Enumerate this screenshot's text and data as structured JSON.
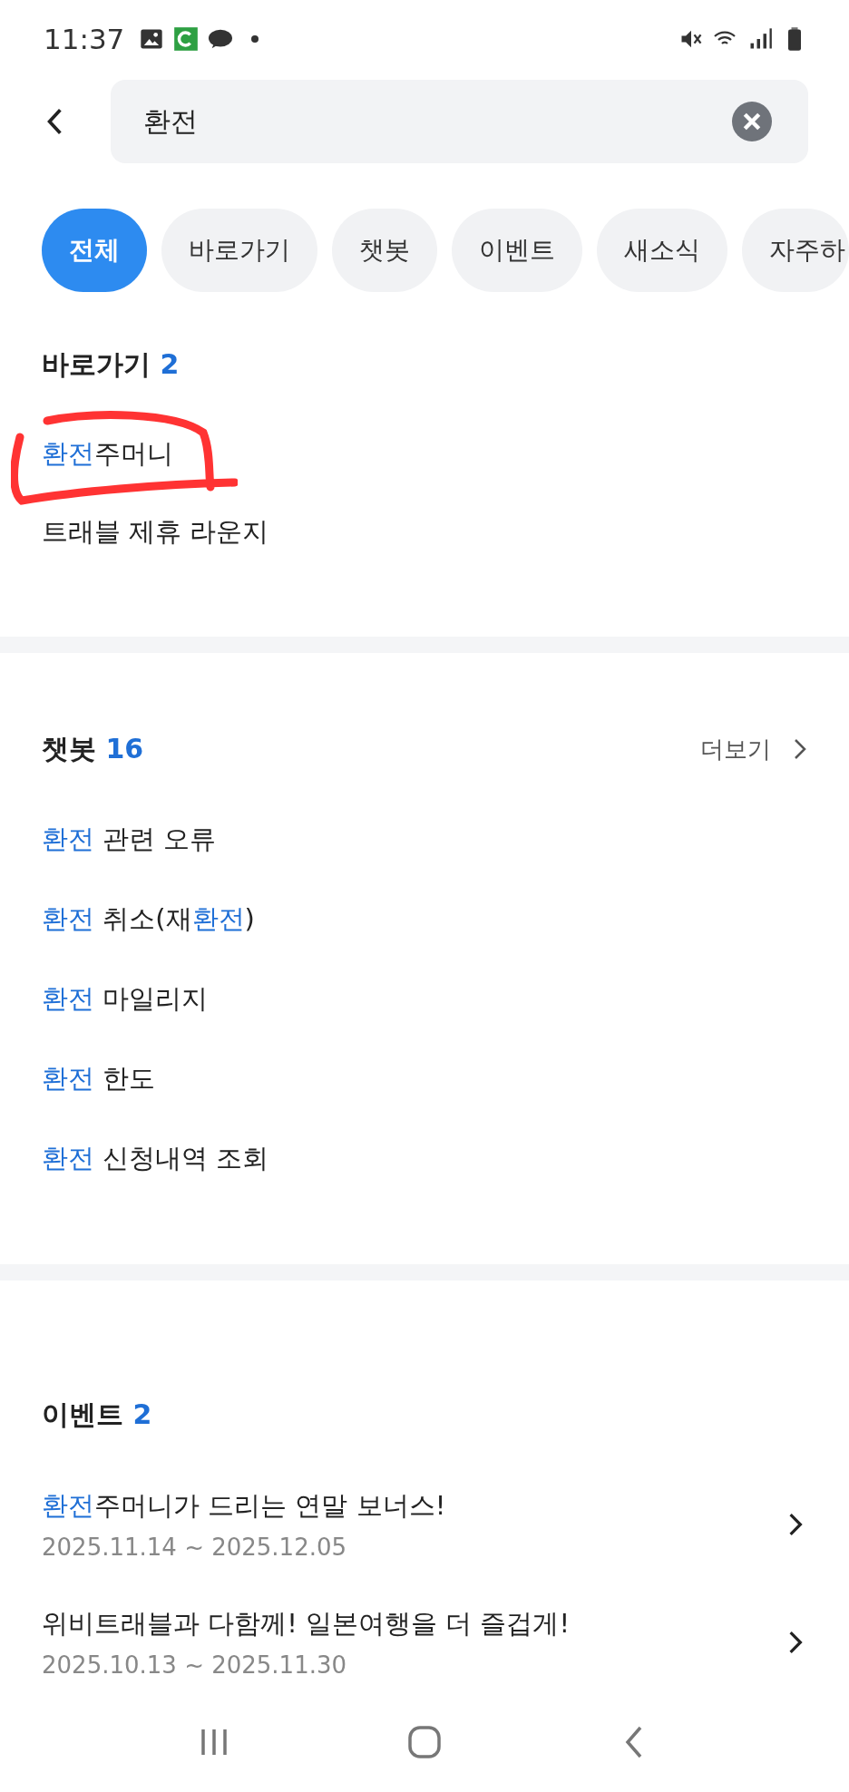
{
  "status_bar": {
    "time": "11:37"
  },
  "search": {
    "value": "환전"
  },
  "chips": [
    {
      "label": "전체",
      "selected": true
    },
    {
      "label": "바로가기",
      "selected": false
    },
    {
      "label": "챗봇",
      "selected": false
    },
    {
      "label": "이벤트",
      "selected": false
    },
    {
      "label": "새소식",
      "selected": false
    },
    {
      "label": "자주하",
      "selected": false
    }
  ],
  "shortcuts": {
    "title": "바로가기",
    "count": "2",
    "items": [
      {
        "parts": [
          {
            "text": "환전",
            "match": true
          },
          {
            "text": "주머니",
            "match": false
          }
        ],
        "circled": true
      },
      {
        "parts": [
          {
            "text": "트래블 제휴 라운지",
            "match": false
          }
        ],
        "circled": false
      }
    ]
  },
  "chatbot": {
    "title": "챗봇",
    "count": "16",
    "more": "더보기",
    "items": [
      {
        "parts": [
          {
            "text": "환전",
            "match": true
          },
          {
            "text": " 관련 오류",
            "match": false
          }
        ]
      },
      {
        "parts": [
          {
            "text": "환전",
            "match": true
          },
          {
            "text": " 취소(재",
            "match": false
          },
          {
            "text": "환전",
            "match": true
          },
          {
            "text": ")",
            "match": false
          }
        ]
      },
      {
        "parts": [
          {
            "text": "환전",
            "match": true
          },
          {
            "text": " 마일리지",
            "match": false
          }
        ]
      },
      {
        "parts": [
          {
            "text": "환전",
            "match": true
          },
          {
            "text": " 한도",
            "match": false
          }
        ]
      },
      {
        "parts": [
          {
            "text": "환전",
            "match": true
          },
          {
            "text": " 신청내역 조회",
            "match": false
          }
        ]
      }
    ]
  },
  "events": {
    "title": "이벤트",
    "count": "2",
    "items": [
      {
        "parts": [
          {
            "text": "환전",
            "match": true
          },
          {
            "text": "주머니가 드리는 연말 보너스!",
            "match": false
          }
        ],
        "period": "2025.11.14 ~ 2025.12.05"
      },
      {
        "parts": [
          {
            "text": "위비트래블과 다함께! 일본여행을 더 즐겁게!",
            "match": false
          }
        ],
        "period": "2025.10.13 ~ 2025.11.30"
      }
    ]
  }
}
